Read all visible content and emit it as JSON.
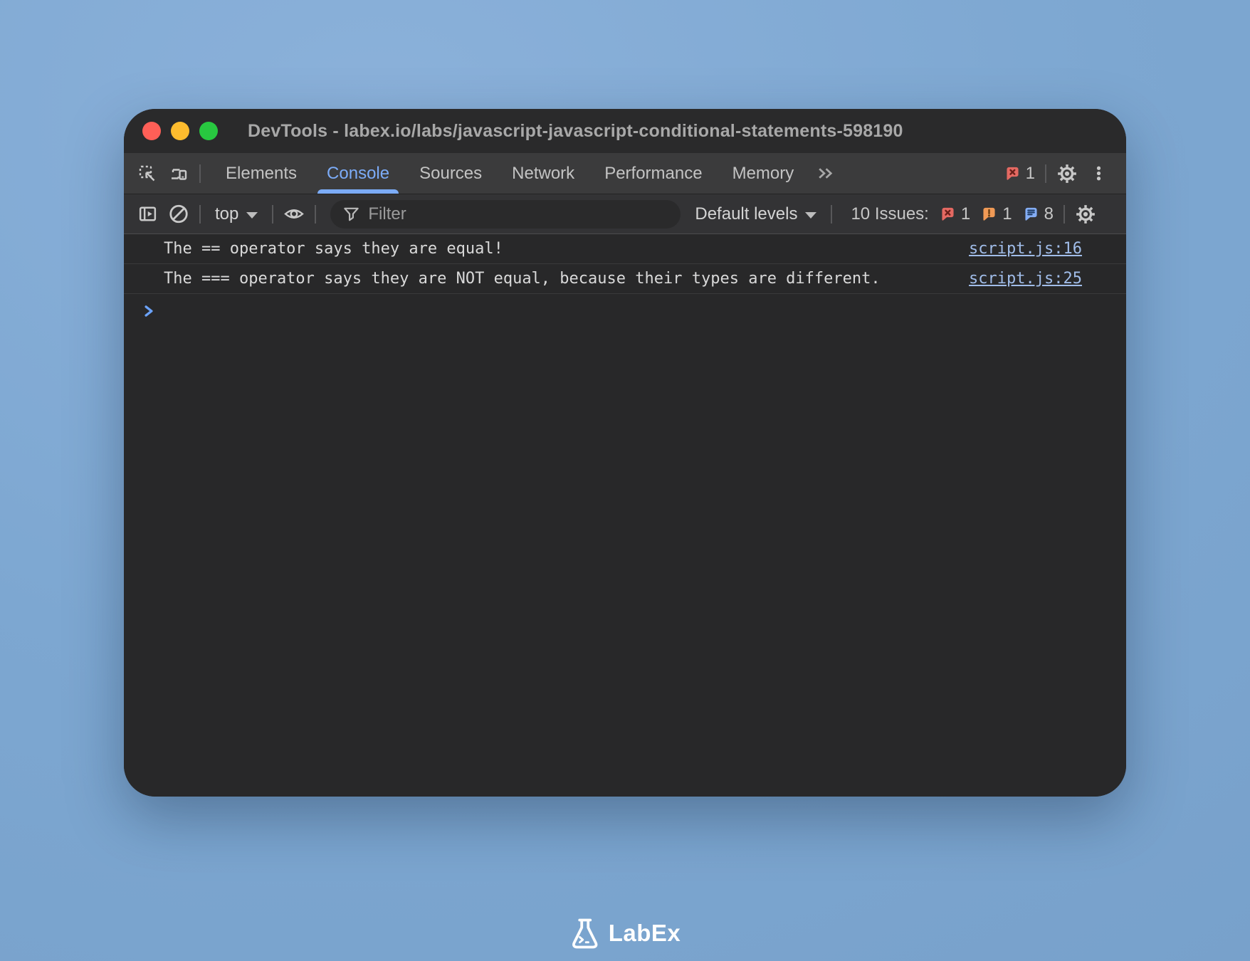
{
  "window": {
    "title": "DevTools - labex.io/labs/javascript-javascript-conditional-statements-598190"
  },
  "tabbar": {
    "tabs": [
      {
        "label": "Elements",
        "active": false
      },
      {
        "label": "Console",
        "active": true
      },
      {
        "label": "Sources",
        "active": false
      },
      {
        "label": "Network",
        "active": false
      },
      {
        "label": "Performance",
        "active": false
      },
      {
        "label": "Memory",
        "active": false
      }
    ],
    "error_badge_count": "1"
  },
  "console_toolbar": {
    "context_selector": "top",
    "filter_placeholder": "Filter",
    "levels_selector": "Default levels",
    "issues_label": "10 Issues:",
    "issues": {
      "errors": "1",
      "warnings": "1",
      "info": "8"
    }
  },
  "console": {
    "messages": [
      {
        "text": "The == operator says they are equal!",
        "source": "script.js:16"
      },
      {
        "text": "The === operator says they are NOT equal, because their types are different.",
        "source": "script.js:25"
      }
    ]
  },
  "footer": {
    "brand": "LabEx"
  },
  "colors": {
    "accent_blue": "#7cacf8",
    "link_blue": "#a1bde9",
    "prompt_blue": "#6ba2f8",
    "error_red": "#e46962",
    "warning_orange": "#f09a56",
    "info_blue": "#84adf4",
    "traffic_red": "#ff5f57",
    "traffic_yellow": "#febc2e",
    "traffic_green": "#28c840",
    "background_blue": "#7da7d1",
    "panel_dark": "#282829"
  }
}
